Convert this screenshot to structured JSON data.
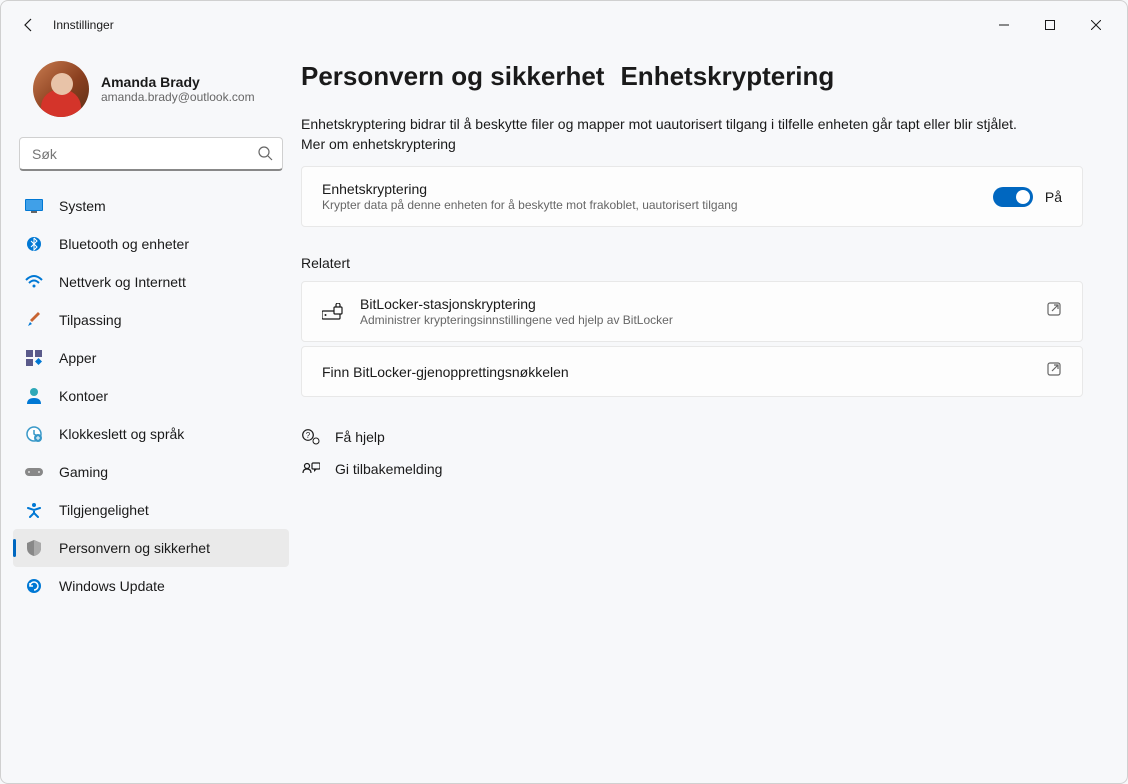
{
  "window": {
    "title": "Innstillinger"
  },
  "profile": {
    "name": "Amanda Brady",
    "email": "amanda.brady@outlook.com"
  },
  "search": {
    "placeholder": "Søk"
  },
  "sidebar": {
    "items": [
      {
        "label": "System",
        "icon": "system"
      },
      {
        "label": "Bluetooth og enheter",
        "icon": "bluetooth"
      },
      {
        "label": "Nettverk og Internett",
        "icon": "wifi"
      },
      {
        "label": "Tilpassing",
        "icon": "brush"
      },
      {
        "label": "Apper",
        "icon": "apps"
      },
      {
        "label": "Kontoer",
        "icon": "person"
      },
      {
        "label": "Klokkeslett og språk",
        "icon": "clock"
      },
      {
        "label": "Gaming",
        "icon": "gamepad"
      },
      {
        "label": "Tilgjengelighet",
        "icon": "accessibility"
      },
      {
        "label": "Personvern og sikkerhet",
        "icon": "shield",
        "active": true
      },
      {
        "label": "Windows Update",
        "icon": "update"
      }
    ]
  },
  "breadcrumb": {
    "parent": "Personvern og sikkerhet",
    "current": "Enhetskryptering"
  },
  "main": {
    "description": "Enhetskryptering bidrar til å beskytte filer og mapper mot uautorisert tilgang i tilfelle enheten går tapt eller blir stjålet.",
    "learn_more": "Mer om enhetskryptering",
    "encryption": {
      "title": "Enhetskryptering",
      "subtitle": "Krypter data på denne enheten for å beskytte mot frakoblet, uautorisert tilgang",
      "toggle_state": "På"
    },
    "related_label": "Relatert",
    "bitlocker": {
      "title": "BitLocker-stasjonskryptering",
      "subtitle": "Administrer krypteringsinnstillingene ved hjelp av BitLocker"
    },
    "recovery": {
      "title": "Finn BitLocker-gjenopprettingsnøkkelen"
    }
  },
  "footer": {
    "help": "Få hjelp",
    "feedback": "Gi tilbakemelding"
  }
}
